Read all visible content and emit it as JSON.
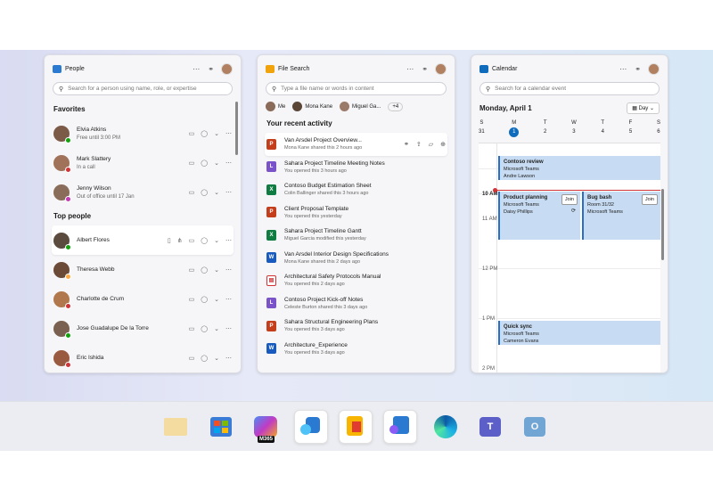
{
  "people": {
    "title": "People",
    "search_placeholder": "Search for a person using name, role, or expertise",
    "favorites_label": "Favorites",
    "top_label": "Top people",
    "favorites": [
      {
        "name": "Elvia Atkins",
        "status": "Free until 3:00 PM"
      },
      {
        "name": "Mark Slattery",
        "status": "In a call"
      },
      {
        "name": "Jenny Wilson",
        "status": "Out of office until 17 Jan"
      }
    ],
    "top": [
      {
        "name": "Albert Flores"
      },
      {
        "name": "Theresa Webb"
      },
      {
        "name": "Charlotte de Crum"
      },
      {
        "name": "Jose Guadalupe De la Torre"
      },
      {
        "name": "Eric Ishida"
      }
    ]
  },
  "files": {
    "title": "File Search",
    "search_placeholder": "Type a file name or words in content",
    "chips": [
      "Me",
      "Mona Kane",
      "Miguel Ga..."
    ],
    "more": "+4",
    "section": "Your recent activity",
    "items": [
      {
        "name": "Van Arsdel Project Overview...",
        "sub": "Mona Kane shared this 2 hours ago",
        "type": "ppt"
      },
      {
        "name": "Sahara Project Timeline Meeting Notes",
        "sub": "You opened this 3 hours ago",
        "type": "loop"
      },
      {
        "name": "Contoso Budget Estimation Sheet",
        "sub": "Colin Ballinger shared this 3 hours ago",
        "type": "xls"
      },
      {
        "name": "Client Proposal Template",
        "sub": "You opened this yesterday",
        "type": "ppt"
      },
      {
        "name": "Sahara Project Timeline Gantt",
        "sub": "Miguel Garcia modified this yesterday",
        "type": "xls"
      },
      {
        "name": "Van Arsdel Interior Design Specifications",
        "sub": "Mona Kane shared this 2 days ago",
        "type": "doc"
      },
      {
        "name": "Architectural Safety Protocols Manual",
        "sub": "You opened this 2 days ago",
        "type": "pdf"
      },
      {
        "name": "Contoso Project Kick-off  Notes",
        "sub": "Celeste Burton shared this 3 days ago",
        "type": "loop"
      },
      {
        "name": "Sahara Structural Engineering Plans",
        "sub": "You opened this 3 days ago",
        "type": "ppt"
      },
      {
        "name": "Architecture_Experience",
        "sub": "You opened this 3 days ago",
        "type": "doc"
      }
    ]
  },
  "calendar": {
    "title": "Calendar",
    "search_placeholder": "Search for a calendar event",
    "date": "Monday, April 1",
    "view": "Day",
    "days": [
      {
        "l": "S",
        "n": "31"
      },
      {
        "l": "M",
        "n": "1"
      },
      {
        "l": "T",
        "n": "2"
      },
      {
        "l": "W",
        "n": "3"
      },
      {
        "l": "T",
        "n": "4"
      },
      {
        "l": "F",
        "n": "5"
      },
      {
        "l": "S",
        "n": "6"
      }
    ],
    "hours": [
      "10 AM",
      "11 AM",
      "12 PM",
      "1 PM",
      "2 PM"
    ],
    "events": [
      {
        "t": "Contoso review",
        "a": "Microsoft Teams",
        "b": "Andre Lawson"
      },
      {
        "t": "Product planning",
        "a": "Microsoft Teams",
        "b": "Daisy Phillips",
        "join": "Join"
      },
      {
        "t": "Bug bash",
        "a": "Room 31/32",
        "b": "Microsoft Teams",
        "join": "Join"
      },
      {
        "t": "Quick sync",
        "a": "Microsoft Teams",
        "b": "Cameron Evans"
      }
    ]
  },
  "taskbar": {
    "m365_label": "M365"
  },
  "colors": {
    "accent": "#0f6cbd",
    "event": "#c7dcf3",
    "now": "#d13438"
  }
}
